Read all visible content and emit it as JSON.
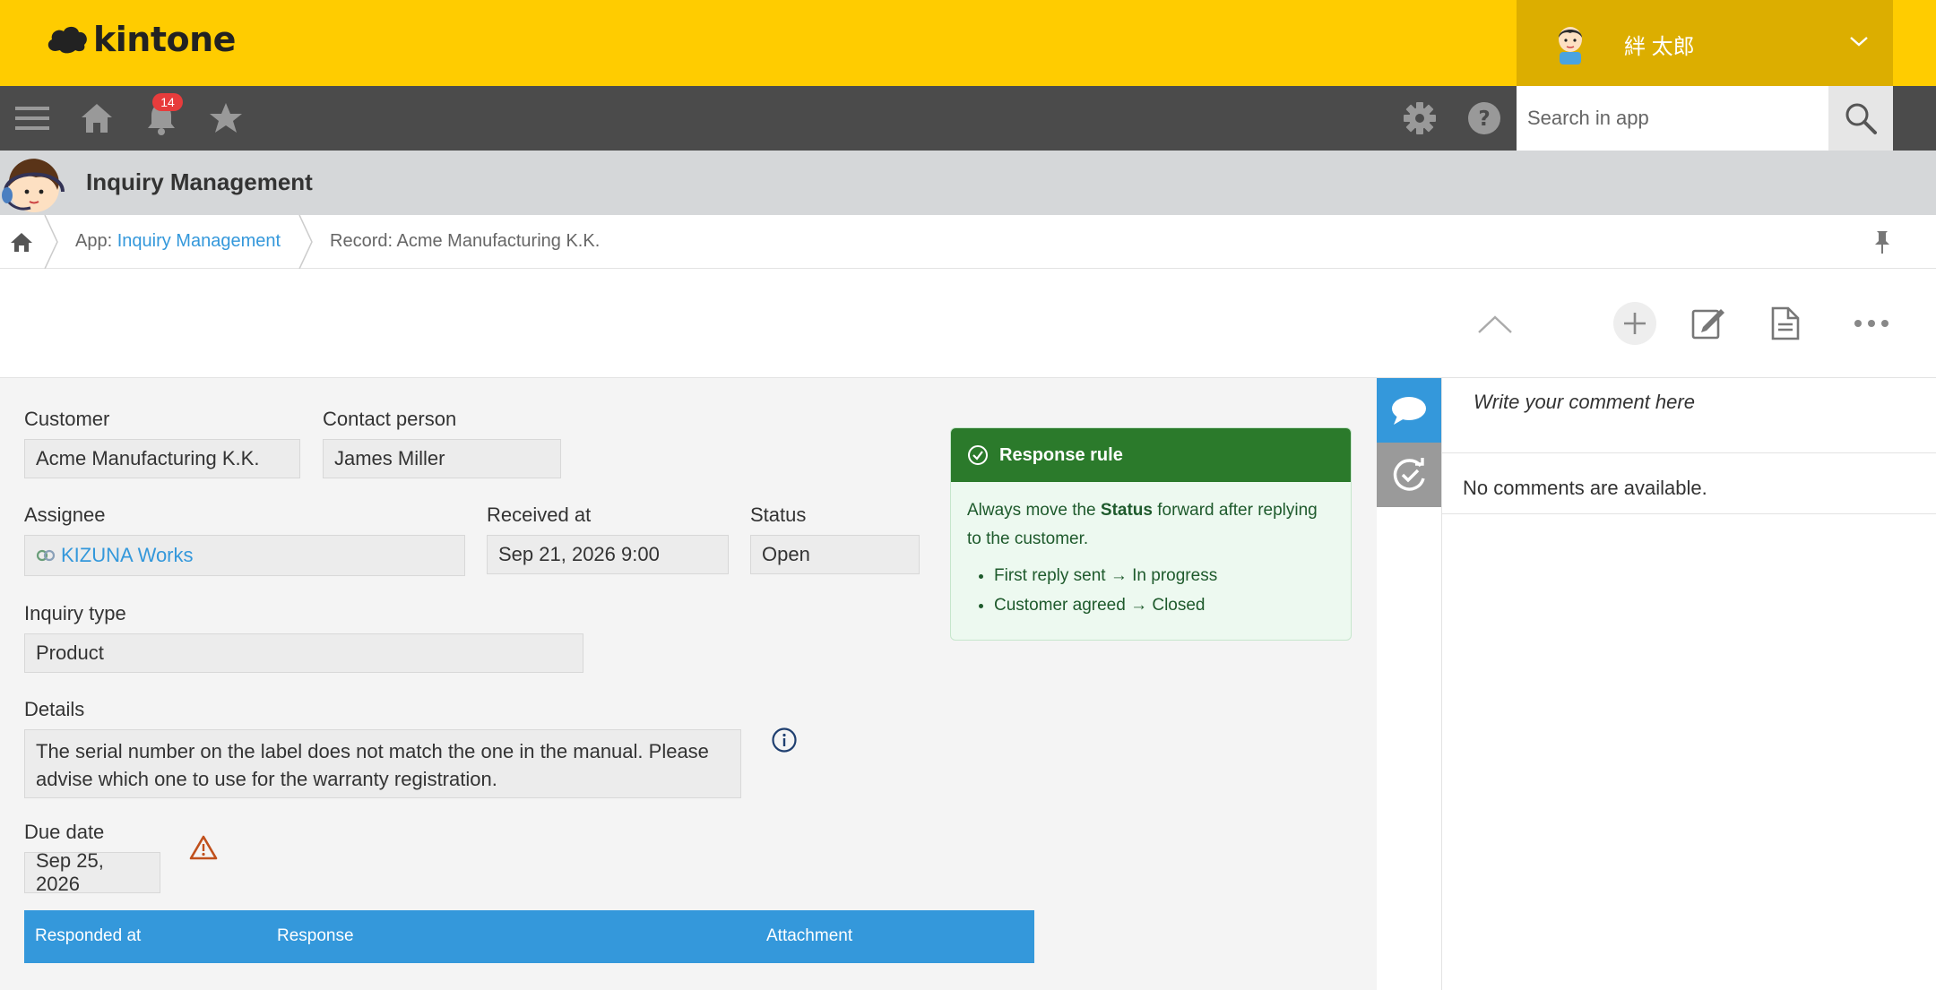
{
  "header": {
    "logo_text": "kintone",
    "user_name": "絆 太郎"
  },
  "navbar": {
    "notification_count": "14",
    "search_placeholder": "Search in app"
  },
  "app": {
    "title": "Inquiry Management"
  },
  "breadcrumb": {
    "app_prefix": "App: ",
    "app_name": "Inquiry Management",
    "record": "Record: Acme Manufacturing K.K."
  },
  "form": {
    "customer_label": "Customer",
    "customer_value": "Acme Manufacturing K.K.",
    "contact_label": "Contact person",
    "contact_value": "James Miller",
    "assignee_label": "Assignee",
    "assignee_value": "KIZUNA Works",
    "received_label": "Received at",
    "received_value": "Sep 21, 2026 9:00",
    "status_label": "Status",
    "status_value": "Open",
    "inquiry_type_label": "Inquiry type",
    "inquiry_type_value": "Product",
    "details_label": "Details",
    "details_value": "The serial number on the label does not match the one in the manual. Please advise which one to use for the warranty registration.",
    "due_label": "Due date",
    "due_value": "Sep 25, 2026"
  },
  "rule": {
    "title": "Response rule",
    "text_before": "Always move the ",
    "text_bold": "Status",
    "text_after": " forward after replying to the customer.",
    "items": [
      "First reply sent → In progress",
      "Customer agreed → Closed"
    ]
  },
  "table": {
    "columns": [
      "Responded at",
      "Response",
      "Attachment"
    ]
  },
  "side": {
    "comment_placeholder": "Write your comment here",
    "no_comments": "No comments are available."
  },
  "colors": {
    "header_yellow": "#ffcc00",
    "navbar": "#4b4b4b",
    "accent_blue": "#3498db",
    "rule_green": "#2b7a2b"
  }
}
